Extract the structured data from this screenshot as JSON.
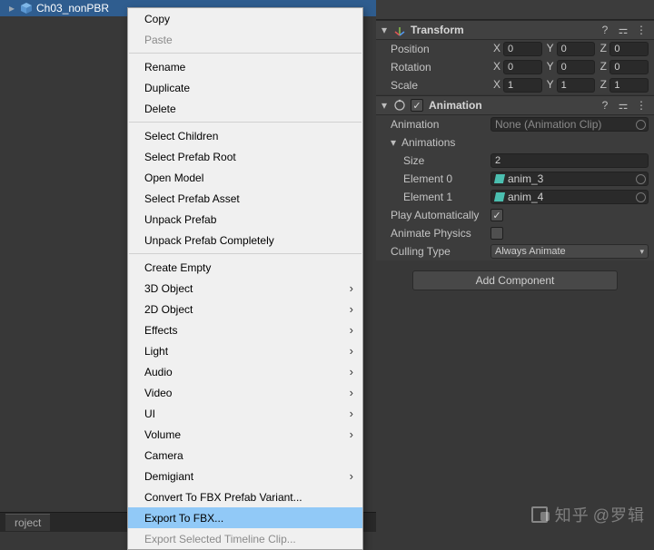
{
  "hierarchy": {
    "selected_item": "Ch03_nonPBR"
  },
  "project": {
    "tab_label": "roject"
  },
  "context_menu": {
    "items": [
      {
        "label": "Copy",
        "sub": false
      },
      {
        "label": "Paste",
        "sub": false,
        "disabled": true
      },
      {
        "sep": true
      },
      {
        "label": "Rename",
        "sub": false
      },
      {
        "label": "Duplicate",
        "sub": false
      },
      {
        "label": "Delete",
        "sub": false
      },
      {
        "sep": true
      },
      {
        "label": "Select Children",
        "sub": false
      },
      {
        "label": "Select Prefab Root",
        "sub": false
      },
      {
        "label": "Open Model",
        "sub": false
      },
      {
        "label": "Select Prefab Asset",
        "sub": false
      },
      {
        "label": "Unpack Prefab",
        "sub": false
      },
      {
        "label": "Unpack Prefab Completely",
        "sub": false
      },
      {
        "sep": true
      },
      {
        "label": "Create Empty",
        "sub": false
      },
      {
        "label": "3D Object",
        "sub": true
      },
      {
        "label": "2D Object",
        "sub": true
      },
      {
        "label": "Effects",
        "sub": true
      },
      {
        "label": "Light",
        "sub": true
      },
      {
        "label": "Audio",
        "sub": true
      },
      {
        "label": "Video",
        "sub": true
      },
      {
        "label": "UI",
        "sub": true
      },
      {
        "label": "Volume",
        "sub": true
      },
      {
        "label": "Camera",
        "sub": false
      },
      {
        "label": "Demigiant",
        "sub": true
      },
      {
        "label": "Convert To FBX Prefab Variant...",
        "sub": false
      },
      {
        "label": "Export To FBX...",
        "sub": false,
        "highlight": true
      },
      {
        "label": "Export Selected Timeline Clip...",
        "sub": false,
        "disabled": true
      }
    ]
  },
  "inspector": {
    "transform": {
      "title": "Transform",
      "rows": [
        {
          "label": "Position",
          "x": "0",
          "y": "0",
          "z": "0"
        },
        {
          "label": "Rotation",
          "x": "0",
          "y": "0",
          "z": "0"
        },
        {
          "label": "Scale",
          "x": "1",
          "y": "1",
          "z": "1"
        }
      ],
      "axis": {
        "x": "X",
        "y": "Y",
        "z": "Z"
      }
    },
    "animation": {
      "title": "Animation",
      "enabled": true,
      "clip_label": "Animation",
      "clip_value": "None (Animation Clip)",
      "list_label": "Animations",
      "size_label": "Size",
      "size_value": "2",
      "elements": [
        {
          "label": "Element 0",
          "value": "anim_3"
        },
        {
          "label": "Element 1",
          "value": "anim_4"
        }
      ],
      "play_auto_label": "Play Automatically",
      "play_auto": true,
      "anim_physics_label": "Animate Physics",
      "anim_physics": false,
      "culling_label": "Culling Type",
      "culling_value": "Always Animate"
    },
    "add_component": "Add Component"
  },
  "watermark": {
    "site": "知乎",
    "at": "@罗辑"
  }
}
